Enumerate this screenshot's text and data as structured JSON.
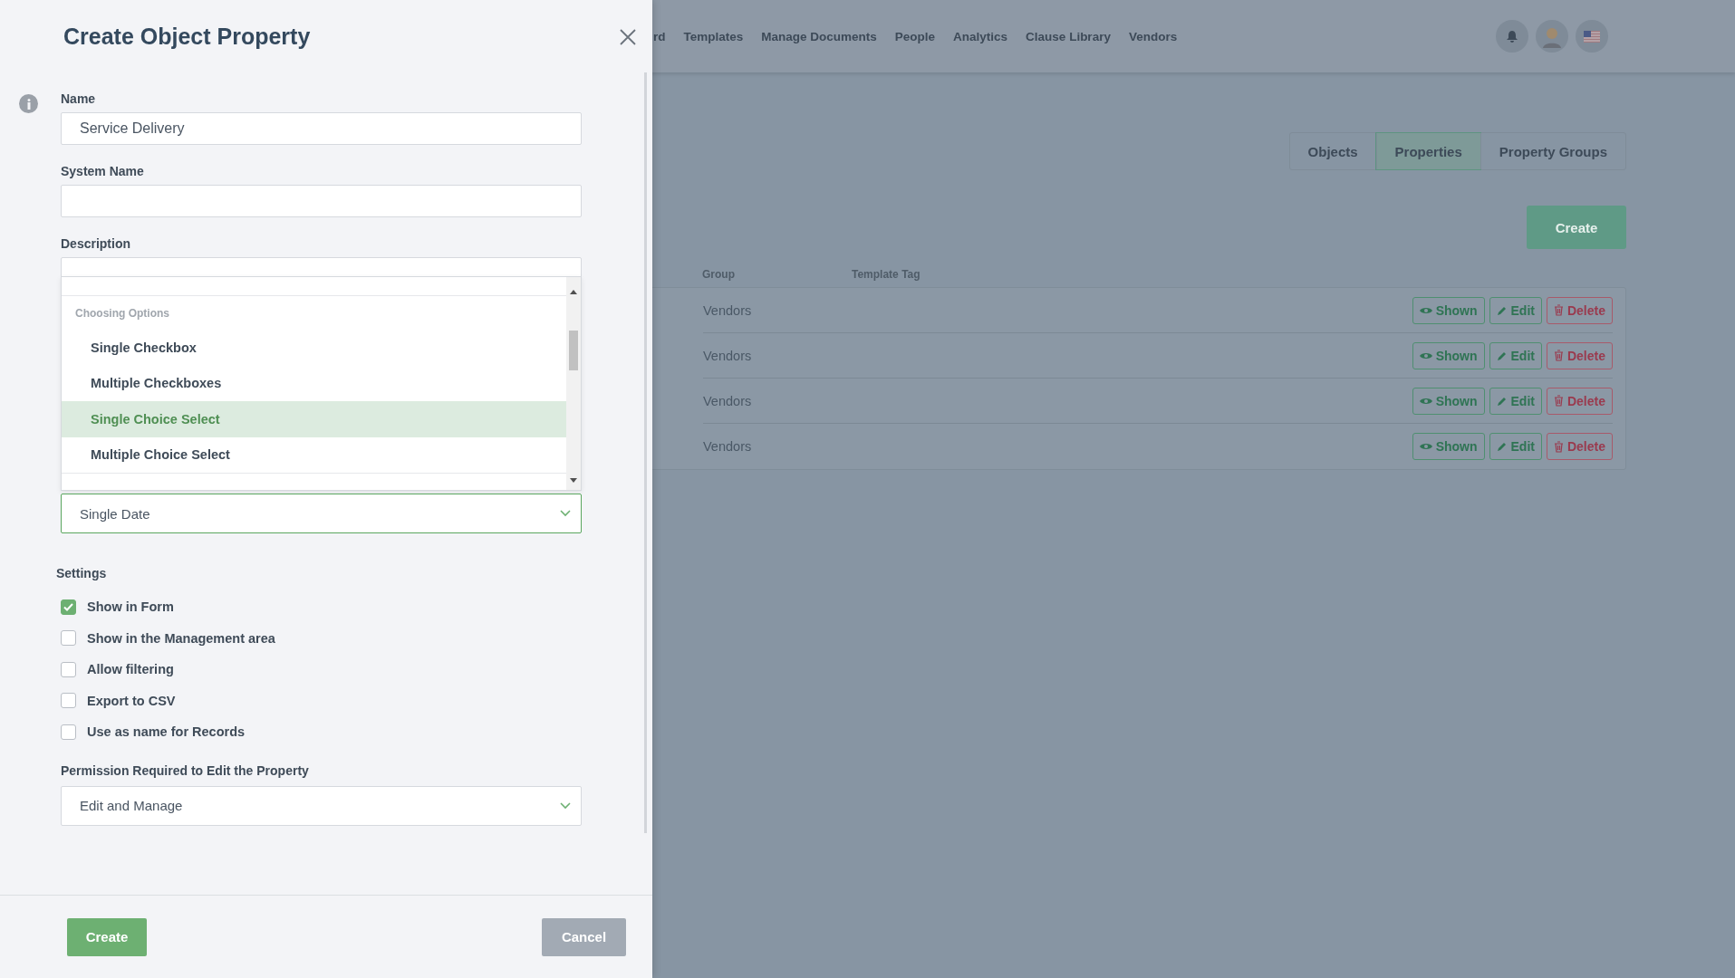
{
  "background": {
    "nav": [
      "rd",
      "Templates",
      "Manage Documents",
      "People",
      "Analytics",
      "Clause Library",
      "Vendors"
    ],
    "tabs": [
      {
        "label": "Objects",
        "selected": false
      },
      {
        "label": "Properties",
        "selected": true
      },
      {
        "label": "Property Groups",
        "selected": false
      }
    ],
    "create_button": "Create",
    "table": {
      "columns": [
        "Group",
        "Template Tag"
      ],
      "rows": [
        {
          "group": "Vendors",
          "actions": [
            {
              "kind": "shown",
              "label": "Shown"
            },
            {
              "kind": "edit",
              "label": "Edit"
            },
            {
              "kind": "delete",
              "label": "Delete"
            }
          ]
        },
        {
          "group": "Vendors",
          "actions": [
            {
              "kind": "shown",
              "label": "Shown"
            },
            {
              "kind": "edit",
              "label": "Edit"
            },
            {
              "kind": "delete",
              "label": "Delete"
            }
          ]
        },
        {
          "group": "Vendors",
          "actions": [
            {
              "kind": "shown",
              "label": "Shown"
            },
            {
              "kind": "edit",
              "label": "Edit"
            },
            {
              "kind": "delete",
              "label": "Delete"
            }
          ]
        },
        {
          "group": "Vendors",
          "actions": [
            {
              "kind": "shown",
              "label": "Shown"
            },
            {
              "kind": "edit",
              "label": "Edit"
            },
            {
              "kind": "delete",
              "label": "Delete"
            }
          ]
        }
      ]
    }
  },
  "panel": {
    "title": "Create Object Property",
    "name_field": {
      "label": "Name",
      "value": "Service Delivery"
    },
    "system_name_field": {
      "label": "System Name"
    },
    "description_field": {
      "label": "Description"
    },
    "type_dropdown": {
      "group_label": "Choosing Options",
      "options": [
        {
          "label": "Single Checkbox",
          "selected": false
        },
        {
          "label": "Multiple Checkboxes",
          "selected": false
        },
        {
          "label": "Single Choice Select",
          "selected": true
        },
        {
          "label": "Multiple Choice Select",
          "selected": false
        }
      ]
    },
    "type_select": {
      "value": "Single Date"
    },
    "settings": {
      "label": "Settings",
      "options": [
        {
          "label": "Show in Form",
          "checked": true
        },
        {
          "label": "Show in the Management area",
          "checked": false
        },
        {
          "label": "Allow filtering",
          "checked": false
        },
        {
          "label": "Export to CSV",
          "checked": false
        },
        {
          "label": "Use as name for Records",
          "checked": false
        }
      ]
    },
    "permission_field": {
      "label": "Permission Required to Edit the Property",
      "value": "Edit and Manage"
    },
    "buttons": {
      "create": "Create",
      "cancel": "Cancel"
    }
  }
}
